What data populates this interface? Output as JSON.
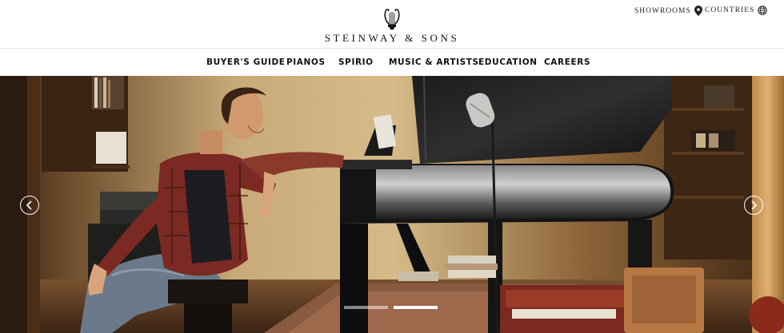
{
  "brand": {
    "name": "STEINWAY & SONS"
  },
  "utility": {
    "showrooms_label": "SHOWROOMS",
    "countries_label": "COUNTRIES"
  },
  "nav": {
    "items": [
      {
        "label": "BUYER'S GUIDE"
      },
      {
        "label": "PIANOS"
      },
      {
        "label": "SPIRIO"
      },
      {
        "label": "MUSIC & ARTISTS"
      },
      {
        "label": "EDUCATION"
      },
      {
        "label": "CAREERS"
      }
    ]
  },
  "hero": {
    "prev_icon": "chevron-left-icon",
    "next_icon": "chevron-right-icon",
    "slides_count_shown": 2,
    "active_slide": 2
  },
  "colors": {
    "header_bg": "#ffffff",
    "text": "#111111",
    "indicator_active": "#ffffff",
    "indicator_inactive": "rgba(255,255,255,0.5)"
  }
}
